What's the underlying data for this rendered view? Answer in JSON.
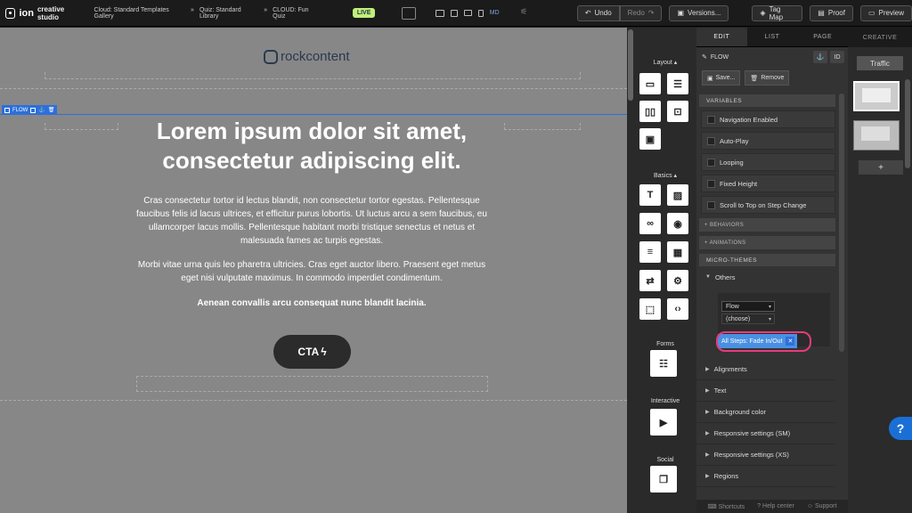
{
  "topbar": {
    "logo_text": "ion",
    "logo_sub": "creative studio",
    "breadcrumbs": [
      "Cloud: Standard Templates Gallery",
      "»",
      "Quiz: Standard Library",
      "»",
      "CLOUD: Fun Quiz"
    ],
    "live_badge": "LIVE",
    "device_size": "MD",
    "undo_label": "Undo",
    "redo_label": "Redo",
    "versions_label": "Versions...",
    "tagmap_label": "Tag Map",
    "proof_label": "Proof",
    "preview_label": "Preview"
  },
  "canvas": {
    "brand": "rockcontent",
    "flow_tag": "FLOW",
    "headline": "Lorem ipsum dolor sit amet, consectetur adipiscing elit.",
    "para1": "Cras consectetur tortor id lectus blandit, non consectetur tortor egestas. Pellentesque faucibus felis id lacus ultrices, et efficitur purus lobortis. Ut luctus arcu a sem faucibus, eu ullamcorper lacus mollis. Pellentesque habitant morbi tristique senectus et netus et malesuada fames ac turpis egestas.",
    "para2": "Morbi vitae urna quis leo pharetra ultricies. Cras eget auctor libero. Praesent eget metus eget nisi vulputate maximus. In commodo imperdiet condimentum.",
    "para3": "Aenean convallis arcu consequat nunc blandit lacinia.",
    "cta_label": "CTA"
  },
  "elements": {
    "layout_label": "Layout",
    "basics_label": "Basics",
    "forms_label": "Forms",
    "interactive_label": "Interactive",
    "social_label": "Social"
  },
  "props": {
    "tabs": [
      "EDIT",
      "LIST",
      "PAGE"
    ],
    "flow_title": "FLOW",
    "id_label": "ID",
    "save_label": "Save...",
    "remove_label": "Remove",
    "variables_header": "VARIABLES",
    "variables": [
      "Navigation Enabled",
      "Auto-Play",
      "Looping",
      "Fixed Height",
      "Scroll to Top on Step Change"
    ],
    "behaviors": "+ BEHAVIORS",
    "animations": "+ ANIMATIONS",
    "micro_themes": "MICRO-THEMES",
    "others": "Others",
    "select_flow": "Flow",
    "select_choose": "(choose)",
    "chip_label": "All Steps: Fade In/Out",
    "chip_close": "✕",
    "accordions": [
      "Alignments",
      "Text",
      "Background color",
      "Responsive settings (SM)",
      "Responsive settings (XS)",
      "Regions"
    ],
    "footer": [
      "Shortcuts",
      "Help center",
      "Support"
    ]
  },
  "creative": {
    "tab": "CREATIVE",
    "traffic": "Traffic",
    "add": "+"
  },
  "help": "?"
}
